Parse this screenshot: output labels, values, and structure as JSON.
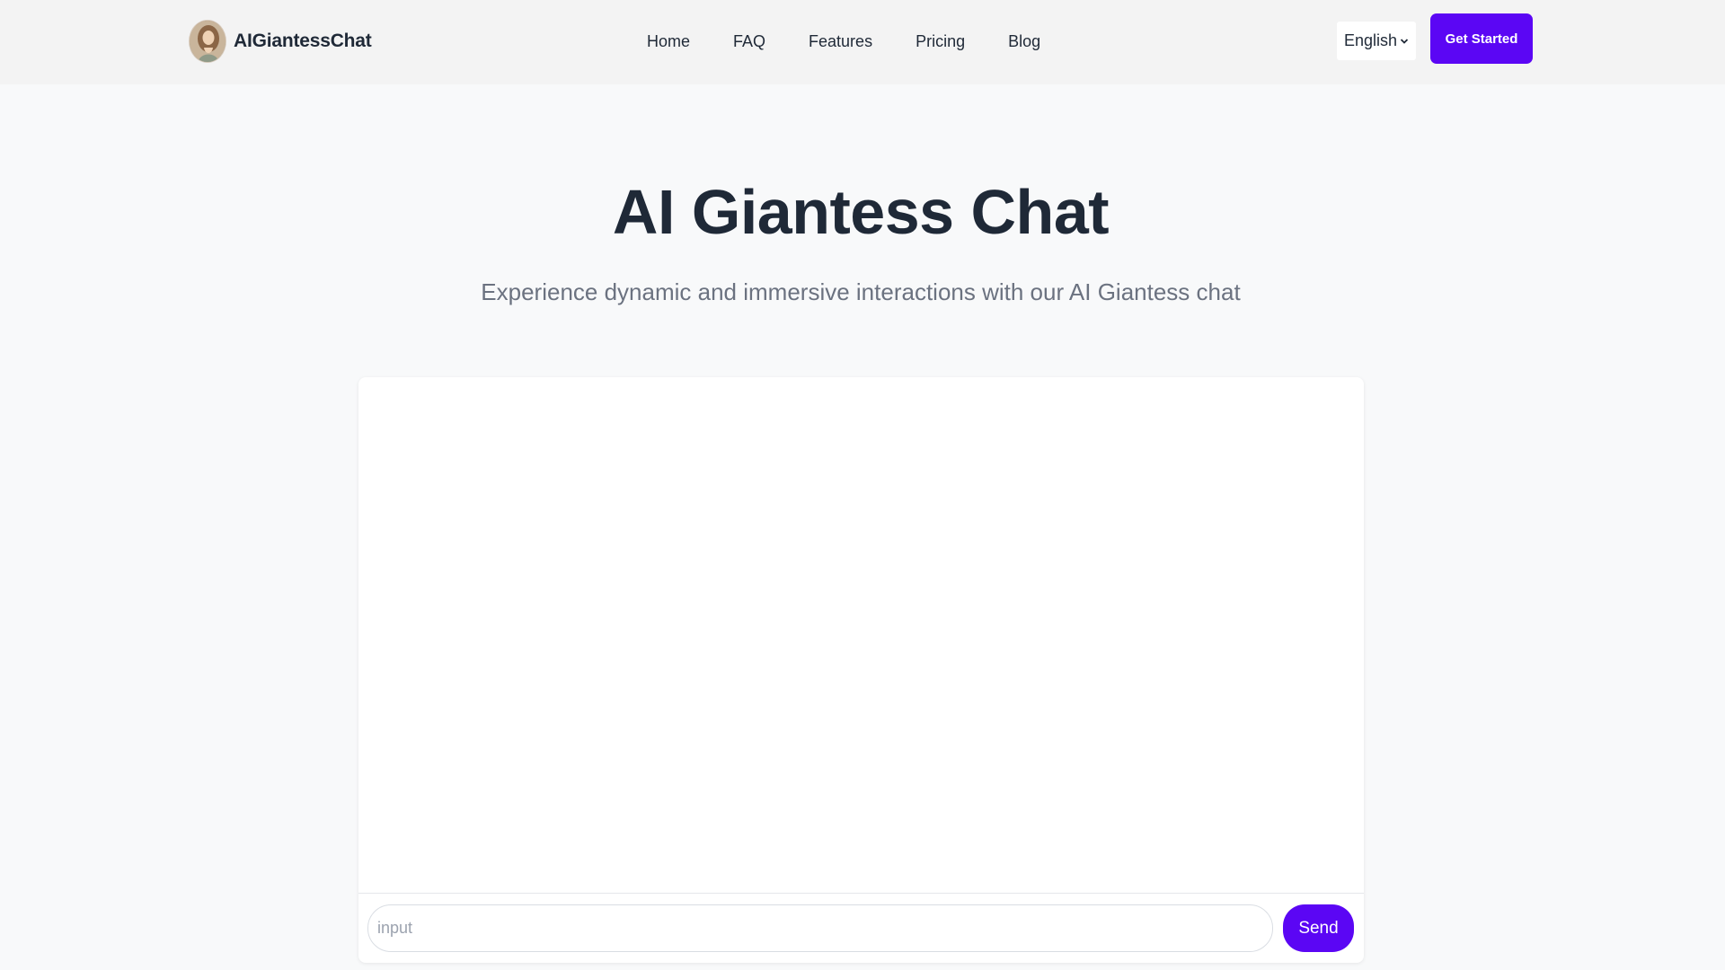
{
  "header": {
    "brand": "AIGiantessChat",
    "nav": [
      "Home",
      "FAQ",
      "Features",
      "Pricing",
      "Blog"
    ],
    "language": "English",
    "cta_label": "Get Started"
  },
  "hero": {
    "title": "AI Giantess Chat",
    "subtitle": "Experience dynamic and immersive interactions with our AI Giantess chat"
  },
  "chat": {
    "input_placeholder": "input",
    "input_value": "",
    "send_label": "Send"
  },
  "colors": {
    "accent": "#5b06f4",
    "header_bg": "#f3f3f3",
    "page_bg": "#f8f9fa"
  },
  "icons": [
    "avatar-icon",
    "chevron-down-icon"
  ]
}
